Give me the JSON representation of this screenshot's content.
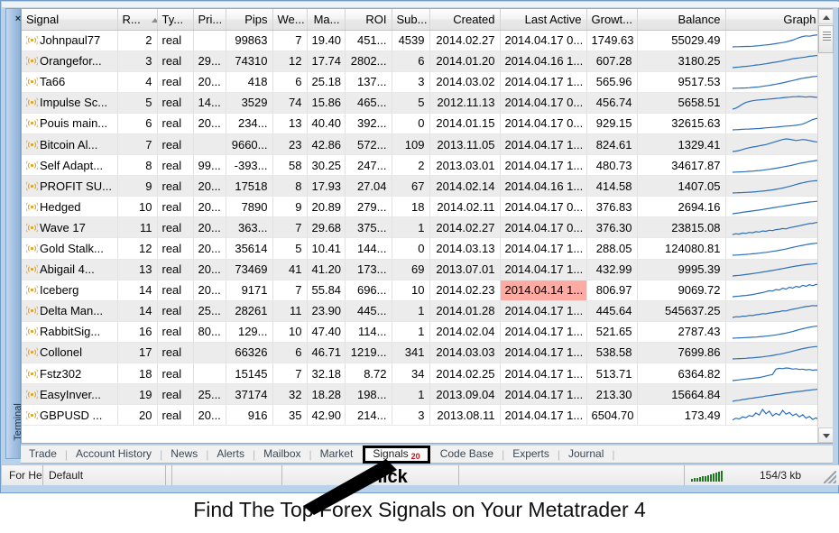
{
  "window": {
    "dock_label": "Terminal",
    "close_icon": "close-icon"
  },
  "table": {
    "columns": [
      {
        "key": "signal",
        "label": "Signal",
        "align": "l"
      },
      {
        "key": "rank",
        "label": "R...",
        "align": "r",
        "sorted": true
      },
      {
        "key": "type",
        "label": "Ty...",
        "align": "l"
      },
      {
        "key": "price",
        "label": "Pri...",
        "align": "r"
      },
      {
        "key": "pips",
        "label": "Pips",
        "align": "r"
      },
      {
        "key": "weeks",
        "label": "We...",
        "align": "r"
      },
      {
        "key": "max",
        "label": "Ma...",
        "align": "r"
      },
      {
        "key": "roi",
        "label": "ROI",
        "align": "r"
      },
      {
        "key": "subs",
        "label": "Sub...",
        "align": "r"
      },
      {
        "key": "created",
        "label": "Created",
        "align": "r"
      },
      {
        "key": "last_active",
        "label": "Last Active",
        "align": "r"
      },
      {
        "key": "growth",
        "label": "Growt...",
        "align": "r"
      },
      {
        "key": "balance",
        "label": "Balance",
        "align": "r"
      },
      {
        "key": "graph",
        "label": "Graph",
        "align": "r"
      }
    ],
    "rows": [
      {
        "signal": "Johnpaul77",
        "rank": "2",
        "type": "real",
        "price": "",
        "pips": "99863",
        "weeks": "7",
        "max": "19.40",
        "roi": "451...",
        "subs": "4539",
        "created": "2014.02.27",
        "last_active": "2014.04.17 0...",
        "growth": "1749.63",
        "balance": "55029.49",
        "spark": [
          2,
          3,
          3,
          4,
          5,
          5,
          6,
          8,
          9,
          12,
          14,
          16,
          19,
          22,
          26,
          29,
          33,
          38,
          44,
          52,
          60,
          66,
          70,
          68,
          72,
          75,
          78,
          80
        ],
        "highlight": false
      },
      {
        "signal": "Orangefor...",
        "rank": "3",
        "type": "real",
        "price": "29...",
        "pips": "74310",
        "weeks": "12",
        "max": "17.74",
        "roi": "2802...",
        "subs": "6",
        "created": "2014.01.20",
        "last_active": "2014.04.16 1...",
        "growth": "607.28",
        "balance": "3180.25",
        "spark": [
          2,
          4,
          6,
          8,
          10,
          12,
          15,
          18,
          20,
          23,
          26,
          30,
          33,
          36,
          40,
          44,
          48,
          52,
          57,
          60,
          62,
          65,
          68,
          72,
          74,
          76,
          78,
          80
        ],
        "highlight": false
      },
      {
        "signal": "Ta66",
        "rank": "4",
        "type": "real",
        "price": "20...",
        "pips": "418",
        "weeks": "6",
        "max": "25.18",
        "roi": "137...",
        "subs": "3",
        "created": "2014.03.02",
        "last_active": "2014.04.17 1...",
        "growth": "565.96",
        "balance": "9517.53",
        "spark": [
          1,
          2,
          2,
          3,
          4,
          5,
          7,
          9,
          11,
          14,
          17,
          20,
          24,
          28,
          32,
          36,
          41,
          46,
          51,
          56,
          61,
          65,
          69,
          72,
          75,
          77,
          79,
          81
        ],
        "highlight": false
      },
      {
        "signal": "Impulse Sc...",
        "rank": "5",
        "type": "real",
        "price": "14...",
        "pips": "3529",
        "weeks": "74",
        "max": "15.86",
        "roi": "465...",
        "subs": "5",
        "created": "2012.11.13",
        "last_active": "2014.04.17 0...",
        "growth": "456.74",
        "balance": "5658.51",
        "spark": [
          2,
          8,
          20,
          34,
          44,
          50,
          55,
          58,
          60,
          62,
          64,
          66,
          68,
          70,
          72,
          74,
          76,
          78,
          80,
          81,
          82,
          80,
          78,
          81,
          79,
          77,
          76,
          74
        ],
        "highlight": false
      },
      {
        "signal": "Pouis main...",
        "rank": "6",
        "type": "real",
        "price": "20...",
        "pips": "234...",
        "weeks": "13",
        "max": "40.40",
        "roi": "392...",
        "subs": "0",
        "created": "2014.01.15",
        "last_active": "2014.04.17 0...",
        "growth": "929.15",
        "balance": "32615.63",
        "spark": [
          8,
          9,
          10,
          11,
          12,
          13,
          14,
          15,
          16,
          18,
          20,
          21,
          23,
          24,
          26,
          28,
          30,
          31,
          33,
          35,
          38,
          42,
          50,
          60,
          68,
          74,
          78,
          82
        ],
        "highlight": false
      },
      {
        "signal": "Bitcoin Al...",
        "rank": "7",
        "type": "real",
        "price": "",
        "pips": "9660...",
        "weeks": "23",
        "max": "42.86",
        "roi": "572...",
        "subs": "109",
        "created": "2013.11.05",
        "last_active": "2014.04.17 1...",
        "growth": "824.61",
        "balance": "1329.41",
        "spark": [
          4,
          6,
          10,
          16,
          22,
          27,
          31,
          34,
          38,
          42,
          46,
          52,
          58,
          64,
          70,
          76,
          80,
          78,
          74,
          70,
          73,
          76,
          74,
          70,
          66,
          62,
          60,
          58
        ],
        "highlight": false
      },
      {
        "signal": "Self Adapt...",
        "rank": "8",
        "type": "real",
        "price": "99...",
        "pips": "-393...",
        "weeks": "58",
        "max": "30.25",
        "roi": "247...",
        "subs": "2",
        "created": "2013.03.01",
        "last_active": "2014.04.17 1...",
        "growth": "480.73",
        "balance": "34617.87",
        "spark": [
          2,
          3,
          4,
          5,
          6,
          8,
          9,
          11,
          13,
          15,
          18,
          21,
          24,
          27,
          31,
          35,
          39,
          43,
          48,
          53,
          58,
          62,
          66,
          70,
          73,
          76,
          79,
          82
        ],
        "highlight": false
      },
      {
        "signal": "PROFIT SU...",
        "rank": "9",
        "type": "real",
        "price": "20...",
        "pips": "17518",
        "weeks": "8",
        "max": "17.93",
        "roi": "27.04",
        "subs": "67",
        "created": "2014.02.14",
        "last_active": "2014.04.16 1...",
        "growth": "414.58",
        "balance": "1407.05",
        "spark": [
          3,
          4,
          5,
          6,
          7,
          8,
          9,
          11,
          13,
          15,
          17,
          20,
          23,
          26,
          30,
          34,
          39,
          44,
          50,
          56,
          62,
          67,
          71,
          75,
          78,
          80,
          81,
          82
        ],
        "highlight": false
      },
      {
        "signal": "Hedged",
        "rank": "10",
        "type": "real",
        "price": "20...",
        "pips": "7890",
        "weeks": "9",
        "max": "20.89",
        "roi": "279...",
        "subs": "18",
        "created": "2014.02.11",
        "last_active": "2014.04.17 0...",
        "growth": "376.83",
        "balance": "2694.16",
        "spark": [
          2,
          5,
          8,
          11,
          14,
          17,
          20,
          23,
          26,
          29,
          33,
          36,
          40,
          43,
          47,
          50,
          54,
          57,
          61,
          64,
          68,
          71,
          74,
          77,
          79,
          81,
          82,
          83
        ],
        "highlight": false
      },
      {
        "signal": "Wave 17",
        "rank": "11",
        "type": "real",
        "price": "20...",
        "pips": "363...",
        "weeks": "7",
        "max": "29.68",
        "roi": "375...",
        "subs": "1",
        "created": "2014.02.27",
        "last_active": "2014.04.17 0...",
        "growth": "376.30",
        "balance": "23815.08",
        "spark": [
          10,
          14,
          12,
          18,
          16,
          22,
          20,
          26,
          24,
          30,
          28,
          34,
          32,
          38,
          40,
          44,
          42,
          48,
          52,
          56,
          60,
          64,
          68,
          72,
          74,
          78,
          80,
          82
        ],
        "highlight": false
      },
      {
        "signal": "Gold Stalk...",
        "rank": "12",
        "type": "real",
        "price": "20...",
        "pips": "35614",
        "weeks": "5",
        "max": "10.41",
        "roi": "144...",
        "subs": "0",
        "created": "2014.03.13",
        "last_active": "2014.04.17 1...",
        "growth": "288.05",
        "balance": "124080.81",
        "spark": [
          4,
          5,
          6,
          8,
          9,
          11,
          13,
          15,
          17,
          20,
          22,
          25,
          28,
          31,
          35,
          39,
          43,
          48,
          53,
          58,
          62,
          66,
          70,
          74,
          77,
          79,
          81,
          83
        ],
        "highlight": false
      },
      {
        "signal": "Abigail 4...",
        "rank": "13",
        "type": "real",
        "price": "20...",
        "pips": "73469",
        "weeks": "41",
        "max": "41.20",
        "roi": "173...",
        "subs": "69",
        "created": "2013.07.01",
        "last_active": "2014.04.17 1...",
        "growth": "432.99",
        "balance": "9995.39",
        "spark": [
          3,
          5,
          7,
          9,
          12,
          15,
          18,
          21,
          24,
          28,
          31,
          35,
          38,
          42,
          46,
          50,
          54,
          58,
          62,
          66,
          69,
          72,
          75,
          77,
          79,
          81,
          82,
          83
        ],
        "highlight": false
      },
      {
        "signal": "Iceberg",
        "rank": "14",
        "type": "real",
        "price": "20...",
        "pips": "9171",
        "weeks": "7",
        "max": "55.84",
        "roi": "696...",
        "subs": "10",
        "created": "2014.02.23",
        "last_active": "2014.04.14 1...",
        "growth": "806.97",
        "balance": "9069.72",
        "spark": [
          4,
          6,
          8,
          10,
          12,
          15,
          18,
          22,
          26,
          30,
          36,
          42,
          40,
          50,
          46,
          58,
          52,
          64,
          58,
          70,
          64,
          76,
          70,
          80,
          74,
          82,
          78,
          84
        ],
        "highlight": true
      },
      {
        "signal": "Delta Man...",
        "rank": "14",
        "type": "real",
        "price": "25...",
        "pips": "28261",
        "weeks": "11",
        "max": "23.90",
        "roi": "445...",
        "subs": "1",
        "created": "2014.01.28",
        "last_active": "2014.04.17 1...",
        "growth": "445.64",
        "balance": "545637.25",
        "spark": [
          6,
          10,
          9,
          14,
          13,
          18,
          17,
          22,
          24,
          28,
          27,
          32,
          34,
          38,
          40,
          45,
          44,
          50,
          54,
          58,
          62,
          66,
          70,
          72,
          76,
          74,
          78,
          80
        ],
        "highlight": false
      },
      {
        "signal": "RabbitSig...",
        "rank": "16",
        "type": "real",
        "price": "80...",
        "pips": "129...",
        "weeks": "10",
        "max": "47.40",
        "roi": "114...",
        "subs": "1",
        "created": "2014.02.04",
        "last_active": "2014.04.17 1...",
        "growth": "521.65",
        "balance": "2787.43",
        "spark": [
          4,
          5,
          6,
          7,
          8,
          9,
          10,
          11,
          13,
          15,
          17,
          19,
          22,
          25,
          28,
          32,
          36,
          41,
          46,
          52,
          58,
          63,
          68,
          72,
          76,
          79,
          81,
          83
        ],
        "highlight": false
      },
      {
        "signal": "Collonel",
        "rank": "17",
        "type": "real",
        "price": "",
        "pips": "66326",
        "weeks": "6",
        "max": "46.71",
        "roi": "1219...",
        "subs": "341",
        "created": "2014.03.03",
        "last_active": "2014.04.17 1...",
        "growth": "538.58",
        "balance": "7699.86",
        "spark": [
          3,
          4,
          5,
          6,
          7,
          9,
          10,
          12,
          14,
          16,
          19,
          22,
          25,
          29,
          33,
          37,
          42,
          47,
          53,
          58,
          63,
          68,
          72,
          76,
          79,
          81,
          82,
          83
        ],
        "highlight": false
      },
      {
        "signal": "Fstz302",
        "rank": "18",
        "type": "real",
        "price": "",
        "pips": "15145",
        "weeks": "7",
        "max": "32.18",
        "roi": "8.72",
        "subs": "34",
        "created": "2014.02.25",
        "last_active": "2014.04.17 1...",
        "growth": "513.71",
        "balance": "6364.82",
        "spark": [
          10,
          12,
          14,
          16,
          18,
          20,
          22,
          24,
          26,
          30,
          34,
          38,
          42,
          70,
          74,
          72,
          76,
          74,
          70,
          72,
          68,
          70,
          66,
          68,
          64,
          66,
          62,
          64
        ],
        "highlight": false
      },
      {
        "signal": "EasyInver...",
        "rank": "19",
        "type": "real",
        "price": "25...",
        "pips": "37174",
        "weeks": "32",
        "max": "18.28",
        "roi": "198...",
        "subs": "1",
        "created": "2013.09.04",
        "last_active": "2014.04.17 1...",
        "growth": "213.30",
        "balance": "15664.84",
        "spark": [
          12,
          16,
          18,
          22,
          24,
          28,
          30,
          33,
          36,
          38,
          42,
          44,
          47,
          50,
          52,
          55,
          58,
          60,
          63,
          66,
          68,
          70,
          73,
          75,
          77,
          79,
          81,
          83
        ],
        "highlight": false
      },
      {
        "signal": "GBPUSD ...",
        "rank": "20",
        "type": "real",
        "price": "20...",
        "pips": "916",
        "weeks": "35",
        "max": "42.90",
        "roi": "214...",
        "subs": "3",
        "created": "2013.08.11",
        "last_active": "2014.04.17 1...",
        "growth": "6504.70",
        "balance": "173.49",
        "spark": [
          30,
          38,
          34,
          44,
          40,
          50,
          46,
          62,
          52,
          78,
          58,
          70,
          48,
          60,
          52,
          74,
          56,
          64,
          50,
          58,
          44,
          54,
          38,
          46,
          32,
          40,
          26,
          20
        ],
        "highlight": false
      }
    ],
    "row_icon": "signal-broadcast-icon"
  },
  "tabs": {
    "items": [
      {
        "label": "Trade",
        "active": false
      },
      {
        "label": "Account History",
        "active": false
      },
      {
        "label": "News",
        "active": false
      },
      {
        "label": "Alerts",
        "active": false
      },
      {
        "label": "Mailbox",
        "active": false
      },
      {
        "label": "Market",
        "active": false
      }
    ],
    "signals": {
      "label": "Signals",
      "badge": "20",
      "active": true
    },
    "items_after": [
      {
        "label": "Code Base",
        "active": false
      },
      {
        "label": "Experts",
        "active": false
      },
      {
        "label": "Journal",
        "active": false
      }
    ]
  },
  "statusbar": {
    "help": "For He",
    "profile": "Default",
    "traffic_icon": "signal-strength-icon",
    "traffic": "154/3 kb",
    "resize_grip": "resize-grip-icon"
  },
  "annotation": {
    "click_label": "Click",
    "caption": "Find The Top Forex Signals on Your Metatrader 4",
    "arrow_icon": "pointer-arrow-icon"
  },
  "scrollbar": {
    "up_icon": "scroll-up-arrow-icon",
    "down_icon": "scroll-down-arrow-icon",
    "thumb": "scroll-thumb"
  },
  "colors": {
    "highlight_red": "#ffaaa3",
    "sparkline_blue": "#2c6fbb",
    "badge_red": "#cc1111",
    "icon_orange": "#e8a317"
  }
}
